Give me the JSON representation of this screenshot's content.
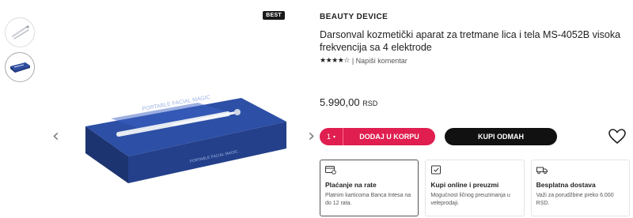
{
  "badge": "BEST",
  "thumbnails": [
    {
      "name": "thumbnail-device"
    },
    {
      "name": "thumbnail-box"
    }
  ],
  "product": {
    "brand": "BEAUTY DEVICE",
    "title": "Darsonval kozmetički aparat za tretmane lica i tela MS-4052B visoka frekvencija sa 4 elektrode",
    "rating_stars": "★★★★☆",
    "rating_value": 4,
    "rating_link": "| Napiši komentar",
    "price": "5.990,00",
    "currency": "RSD"
  },
  "actions": {
    "quantity": "1",
    "add_to_cart": "DODAJ U KORPU",
    "buy_now": "KUPI ODMAH"
  },
  "info_cards": [
    {
      "title": "Plaćanje na rate",
      "text": "Platnim karticoma Banca Intesa na do 12 rata.",
      "icon": "card-icon"
    },
    {
      "title": "Kupi online i preuzmi",
      "text": "Mogućnost ličnog preuzimanja u veleprodaji.",
      "icon": "store-icon"
    },
    {
      "title": "Besplatna dostava",
      "text": "Važi za porudžbine preko 6.000 RSD.",
      "icon": "truck-icon"
    }
  ],
  "colors": {
    "accent": "#e01e4f",
    "dark": "#111111"
  }
}
